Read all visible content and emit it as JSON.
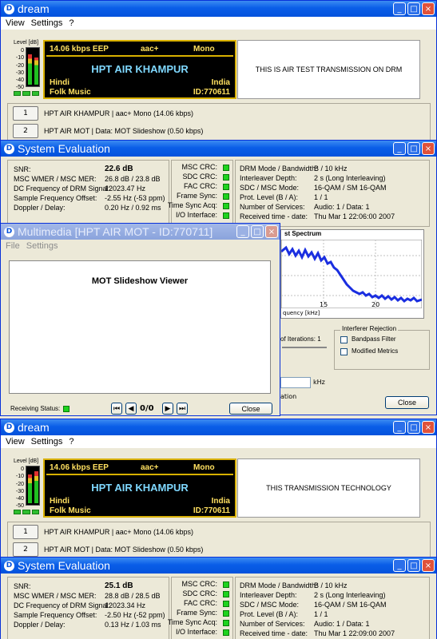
{
  "dream1": {
    "title": "dream",
    "menu": [
      "View",
      "Settings",
      "?"
    ],
    "level_label": "Level [dB]",
    "scale": [
      "0",
      "-10",
      "-20",
      "-30",
      "-40",
      "-50"
    ],
    "bitrate": "14.06 kbps EEP",
    "codec": "aac+",
    "mode": "Mono",
    "station": "HPT AIR KHAMPUR",
    "language": "Hindi",
    "country": "India",
    "genre": "Folk Music",
    "id": "ID:770611",
    "text_message": "THIS IS AIR TEST TRANSMISSION ON DRM",
    "services": [
      {
        "num": "1",
        "label": "HPT AIR KHAMPUR  |   aac+ Mono (14.06 kbps)"
      },
      {
        "num": "2",
        "label": "HPT AIR MOT  |   Data: MOT Slideshow (0.50 kbps)"
      }
    ]
  },
  "eval1": {
    "title": "System Evaluation",
    "left": [
      {
        "l": "SNR:",
        "v": "22.6 dB"
      },
      {
        "l": "MSC WMER / MSC MER:",
        "v": "26.8 dB / 23.8 dB"
      },
      {
        "l": "DC Frequency of DRM Signal:",
        "v": "12023.47 Hz"
      },
      {
        "l": "Sample Frequency Offset:",
        "v": "-2.55 Hz (-53 ppm)"
      },
      {
        "l": "Doppler / Delay:",
        "v": "0.20 Hz / 0.92 ms"
      }
    ],
    "crc": [
      "MSC CRC:",
      "SDC CRC:",
      "FAC CRC:",
      "Frame Sync:",
      "Time Sync Acq:",
      "I/O Interface:"
    ],
    "right": [
      {
        "l": "DRM Mode / Bandwidth:",
        "v": "B / 10 kHz"
      },
      {
        "l": "Interleaver Depth:",
        "v": "2 s (Long Interleaving)"
      },
      {
        "l": "SDC / MSC Mode:",
        "v": "16-QAM / SM 16-QAM"
      },
      {
        "l": "Prot. Level (B / A):",
        "v": "1 / 1"
      },
      {
        "l": "Number of Services:",
        "v": "Audio: 1 / Data: 1"
      },
      {
        "l": "Received time - date:",
        "v": "Thu Mar 1 22:06:00 2007"
      }
    ],
    "spectrum_title": "st Spectrum",
    "axis_ticks": [
      "15",
      "20"
    ],
    "axis_label": "quency [kHz]",
    "iterations": "of Iterations: 1",
    "interferer_title": "Interferer Rejection",
    "bandpass": "Bandpass Filter",
    "modified": "Modified Metrics",
    "khz": "kHz",
    "ation": "ation",
    "close": "Close"
  },
  "mm": {
    "title": "Multimedia [HPT AIR MOT - ID:770711]",
    "menu": [
      "File",
      "Settings"
    ],
    "viewer": "MOT Slideshow Viewer",
    "status": "Receiving Status:",
    "counter": "0/0",
    "close": "Close"
  },
  "dream2": {
    "title": "dream",
    "menu": [
      "View",
      "Settings",
      "?"
    ],
    "level_label": "Level [dB]",
    "scale": [
      "0",
      "-10",
      "-20",
      "-30",
      "-40",
      "-50"
    ],
    "bitrate": "14.06 kbps EEP",
    "codec": "aac+",
    "mode": "Mono",
    "station": "HPT AIR KHAMPUR",
    "language": "Hindi",
    "country": "India",
    "genre": "Folk Music",
    "id": "ID:770611",
    "text_message": "THIS TRANSMISSION TECHNOLOGY",
    "services": [
      {
        "num": "1",
        "label": "HPT AIR KHAMPUR  |   aac+ Mono (14.06 kbps)"
      },
      {
        "num": "2",
        "label": "HPT AIR MOT  |   Data: MOT Slideshow (0.50 kbps)"
      }
    ]
  },
  "eval2": {
    "title": "System Evaluation",
    "left": [
      {
        "l": "SNR:",
        "v": "25.1 dB"
      },
      {
        "l": "MSC WMER / MSC MER:",
        "v": "28.8 dB / 28.5 dB"
      },
      {
        "l": "DC Frequency of DRM Signal:",
        "v": "12023.34 Hz"
      },
      {
        "l": "Sample Frequency Offset:",
        "v": "-2.50 Hz (-52 ppm)"
      },
      {
        "l": "Doppler / Delay:",
        "v": "0.13 Hz / 1.03 ms"
      }
    ],
    "crc": [
      "MSC CRC:",
      "SDC CRC:",
      "FAC CRC:",
      "Frame Sync:",
      "Time Sync Acq:",
      "I/O Interface:"
    ],
    "right": [
      {
        "l": "DRM Mode / Bandwidth:",
        "v": "B / 10 kHz"
      },
      {
        "l": "Interleaver Depth:",
        "v": "2 s (Long Interleaving)"
      },
      {
        "l": "SDC / MSC Mode:",
        "v": "16-QAM / SM 16-QAM"
      },
      {
        "l": "Prot. Level (B / A):",
        "v": "1 / 1"
      },
      {
        "l": "Number of Services:",
        "v": "Audio: 1 / Data: 1"
      },
      {
        "l": "Received time - date:",
        "v": "Thu Mar 1 22:09:00 2007"
      }
    ]
  }
}
